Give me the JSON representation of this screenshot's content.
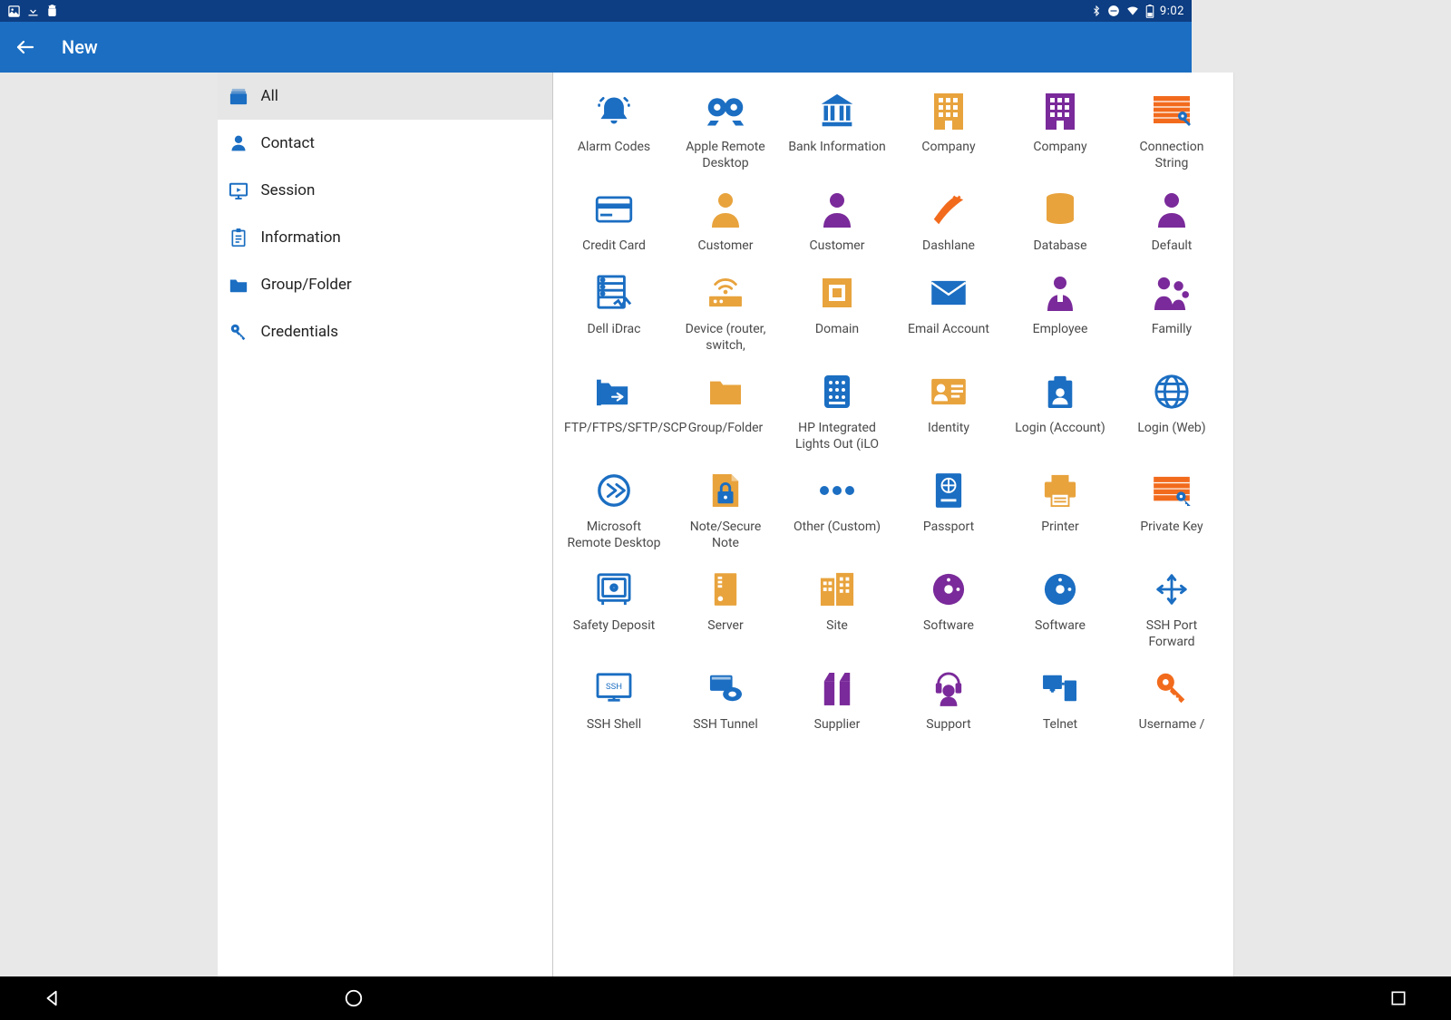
{
  "status": {
    "time": "9:02"
  },
  "appbar": {
    "title": "New"
  },
  "sidebar": [
    {
      "id": "all",
      "label": "All",
      "color": "#1b6ec2",
      "selected": true
    },
    {
      "id": "contact",
      "label": "Contact",
      "color": "#1b6ec2",
      "selected": false
    },
    {
      "id": "session",
      "label": "Session",
      "color": "#1b6ec2",
      "selected": false
    },
    {
      "id": "information",
      "label": "Information",
      "color": "#1b6ec2",
      "selected": false
    },
    {
      "id": "groupfolder",
      "label": "Group/Folder",
      "color": "#1b6ec2",
      "selected": false
    },
    {
      "id": "credentials",
      "label": "Credentials",
      "color": "#1b6ec2",
      "selected": false
    }
  ],
  "grid": [
    {
      "id": "alarm-codes",
      "label": "Alarm Codes",
      "color": "#1b6ec2"
    },
    {
      "id": "apple-rd",
      "label": "Apple Remote Desktop",
      "color": "#1b6ec2"
    },
    {
      "id": "bank-info",
      "label": "Bank Information",
      "color": "#1b6ec2"
    },
    {
      "id": "company-1",
      "label": "Company",
      "color": "#e8a33d"
    },
    {
      "id": "company-2",
      "label": "Company",
      "color": "#7a2a9a"
    },
    {
      "id": "connection-string",
      "label": "Connection String",
      "color": "#f26b1d"
    },
    {
      "id": "credit-card",
      "label": "Credit Card",
      "color": "#1b6ec2"
    },
    {
      "id": "customer-1",
      "label": "Customer",
      "color": "#e8a33d"
    },
    {
      "id": "customer-2",
      "label": "Customer",
      "color": "#7a2a9a"
    },
    {
      "id": "dashlane",
      "label": "Dashlane",
      "color": "#f26b1d"
    },
    {
      "id": "database",
      "label": "Database",
      "color": "#e8a33d"
    },
    {
      "id": "default",
      "label": "Default",
      "color": "#7a2a9a"
    },
    {
      "id": "dell-idrac",
      "label": "Dell iDrac",
      "color": "#1b6ec2"
    },
    {
      "id": "device",
      "label": "Device (router, switch,",
      "color": "#e8a33d"
    },
    {
      "id": "domain",
      "label": "Domain",
      "color": "#e8a33d"
    },
    {
      "id": "email-account",
      "label": "Email Account",
      "color": "#1b6ec2"
    },
    {
      "id": "employee",
      "label": "Employee",
      "color": "#7a2a9a"
    },
    {
      "id": "familly",
      "label": "Familly",
      "color": "#7a2a9a"
    },
    {
      "id": "ftp",
      "label": "FTP/FTPS/SFTP/SCP",
      "color": "#1b6ec2"
    },
    {
      "id": "group-folder",
      "label": "Group/Folder",
      "color": "#e8a33d"
    },
    {
      "id": "hp-ilo",
      "label": "HP Integrated Lights Out (iLO",
      "color": "#1b6ec2"
    },
    {
      "id": "identity",
      "label": "Identity",
      "color": "#e8a33d"
    },
    {
      "id": "login-account",
      "label": "Login (Account)",
      "color": "#1b6ec2"
    },
    {
      "id": "login-web",
      "label": "Login (Web)",
      "color": "#1b6ec2"
    },
    {
      "id": "ms-rd",
      "label": "Microsoft Remote Desktop",
      "color": "#1b6ec2"
    },
    {
      "id": "secure-note",
      "label": "Note/Secure Note",
      "color": "#e8a33d"
    },
    {
      "id": "other-custom",
      "label": "Other (Custom)",
      "color": "#1b6ec2"
    },
    {
      "id": "passport",
      "label": "Passport",
      "color": "#1b6ec2"
    },
    {
      "id": "printer",
      "label": "Printer",
      "color": "#e8a33d"
    },
    {
      "id": "private-key",
      "label": "Private Key",
      "color": "#f26b1d"
    },
    {
      "id": "safety-deposit",
      "label": "Safety Deposit",
      "color": "#1b6ec2"
    },
    {
      "id": "server",
      "label": "Server",
      "color": "#e8a33d"
    },
    {
      "id": "site",
      "label": "Site",
      "color": "#e8a33d"
    },
    {
      "id": "software-1",
      "label": "Software",
      "color": "#7a2a9a"
    },
    {
      "id": "software-2",
      "label": "Software",
      "color": "#1b6ec2"
    },
    {
      "id": "ssh-port-fwd",
      "label": "SSH Port Forward",
      "color": "#1b6ec2"
    },
    {
      "id": "ssh-shell",
      "label": "SSH Shell",
      "color": "#1b6ec2"
    },
    {
      "id": "ssh-tunnel",
      "label": "SSH Tunnel",
      "color": "#1b6ec2"
    },
    {
      "id": "supplier",
      "label": "Supplier",
      "color": "#7a2a9a"
    },
    {
      "id": "support",
      "label": "Support",
      "color": "#7a2a9a"
    },
    {
      "id": "telnet",
      "label": "Telnet",
      "color": "#1b6ec2"
    },
    {
      "id": "username",
      "label": "Username /",
      "color": "#f26b1d"
    }
  ]
}
